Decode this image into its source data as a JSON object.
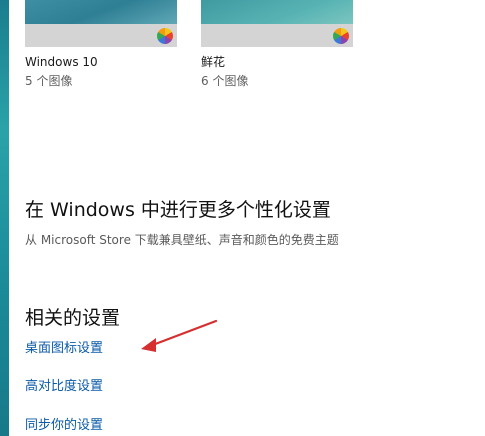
{
  "themes": [
    {
      "name": "Windows 10",
      "count": "5 个图像"
    },
    {
      "name": "鲜花",
      "count": "6 个图像"
    }
  ],
  "more_personalization": {
    "title": "在 Windows 中进行更多个性化设置",
    "description": "从 Microsoft Store 下载兼具壁纸、声音和颜色的免费主题"
  },
  "related_settings": {
    "title": "相关的设置",
    "links": [
      "桌面图标设置",
      "高对比度设置",
      "同步你的设置"
    ]
  },
  "colors": {
    "link": "#0b5aa6",
    "annotation_arrow": "#d62f2f",
    "accent_edge": "#1a7d8f"
  }
}
